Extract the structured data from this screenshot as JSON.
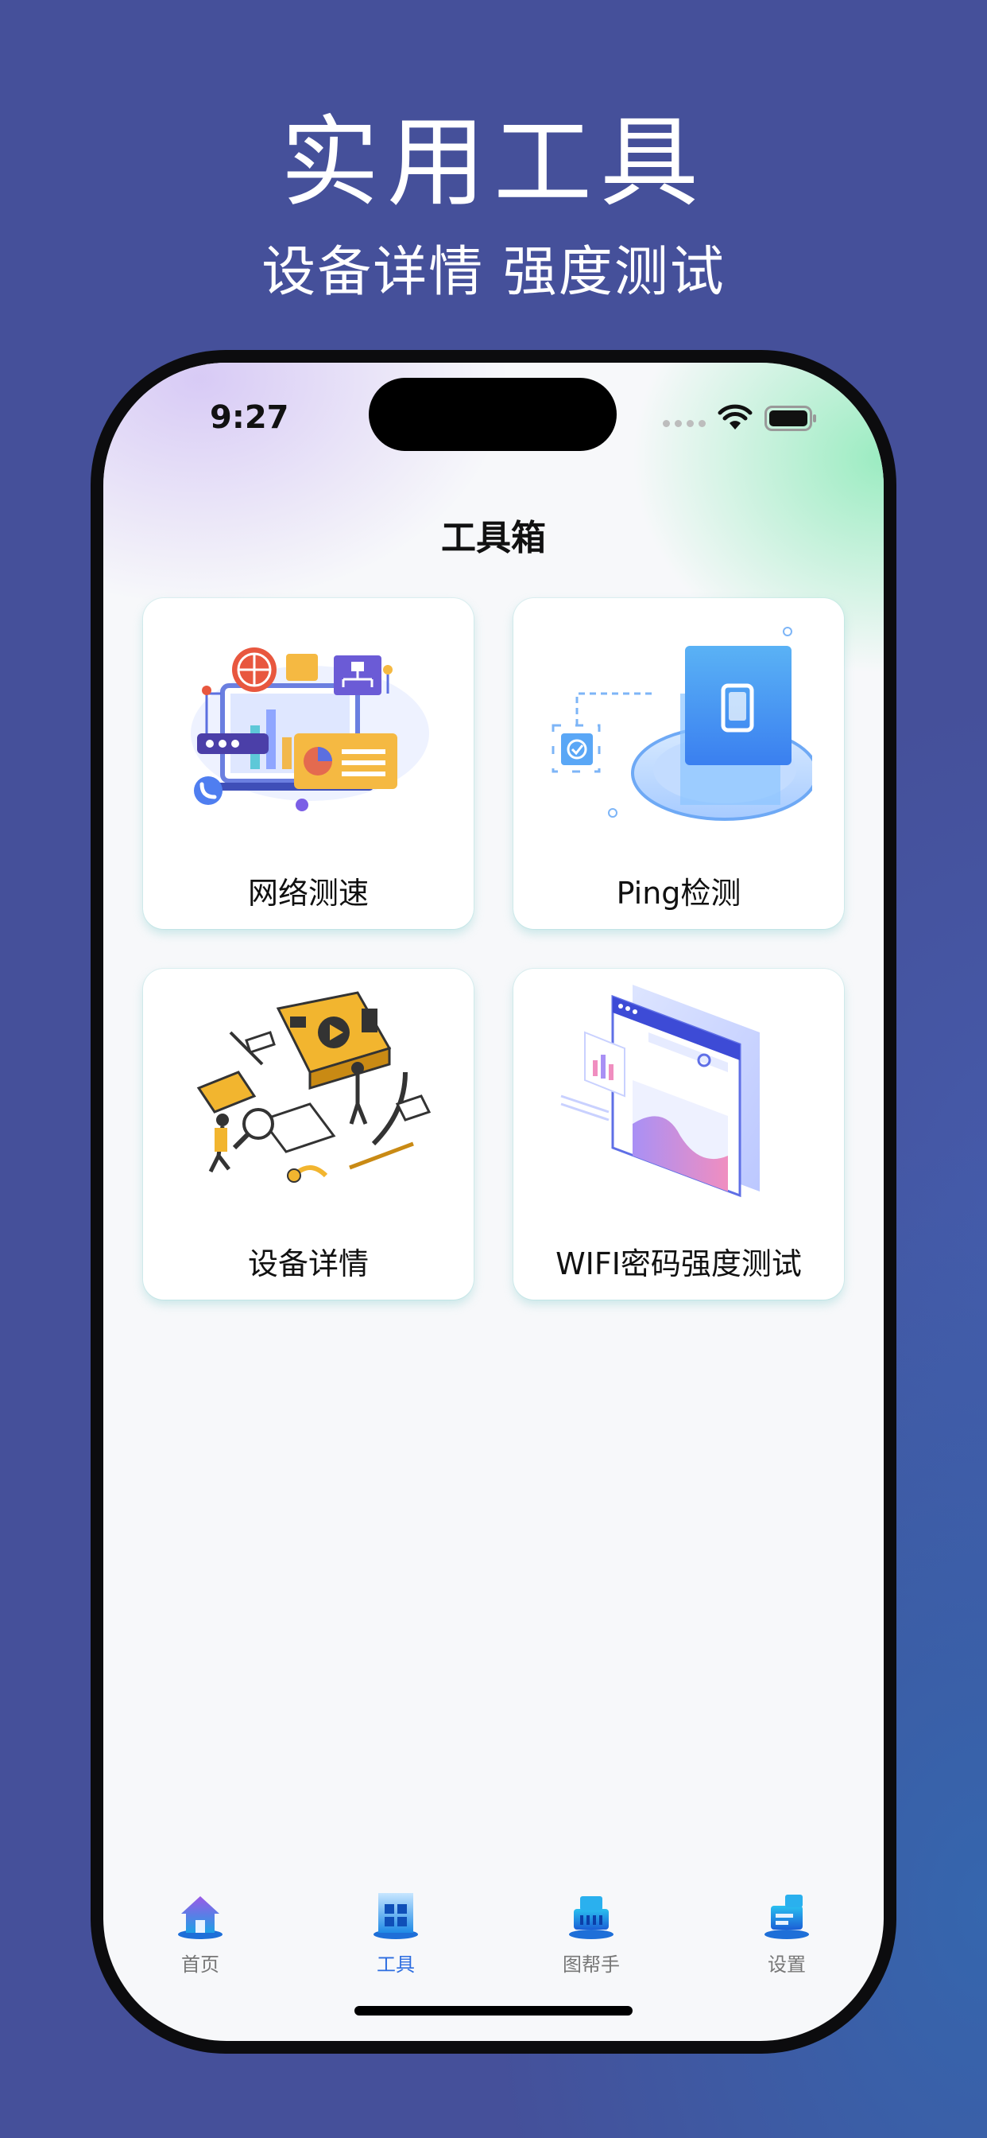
{
  "promo": {
    "title": "实用工具",
    "subtitle": "设备详情 强度测试"
  },
  "status_bar": {
    "time": "9:27"
  },
  "screen": {
    "title": "工具箱"
  },
  "tools": [
    {
      "label": "网络测速",
      "icon": "network-speed-illustration"
    },
    {
      "label": "Ping检测",
      "icon": "ping-phone-illustration"
    },
    {
      "label": "设备详情",
      "icon": "device-details-illustration"
    },
    {
      "label": "WIFI密码强度测试",
      "icon": "browser-window-illustration"
    }
  ],
  "tabbar": {
    "items": [
      {
        "label": "首页",
        "icon": "home-icon",
        "active": false
      },
      {
        "label": "工具",
        "icon": "tools-grid-icon",
        "active": true
      },
      {
        "label": "图帮手",
        "icon": "image-helper-icon",
        "active": false
      },
      {
        "label": "设置",
        "icon": "settings-icon",
        "active": false
      }
    ]
  },
  "colors": {
    "background": "#45509a",
    "accent": "#2d6de0",
    "card": "#ffffff"
  }
}
